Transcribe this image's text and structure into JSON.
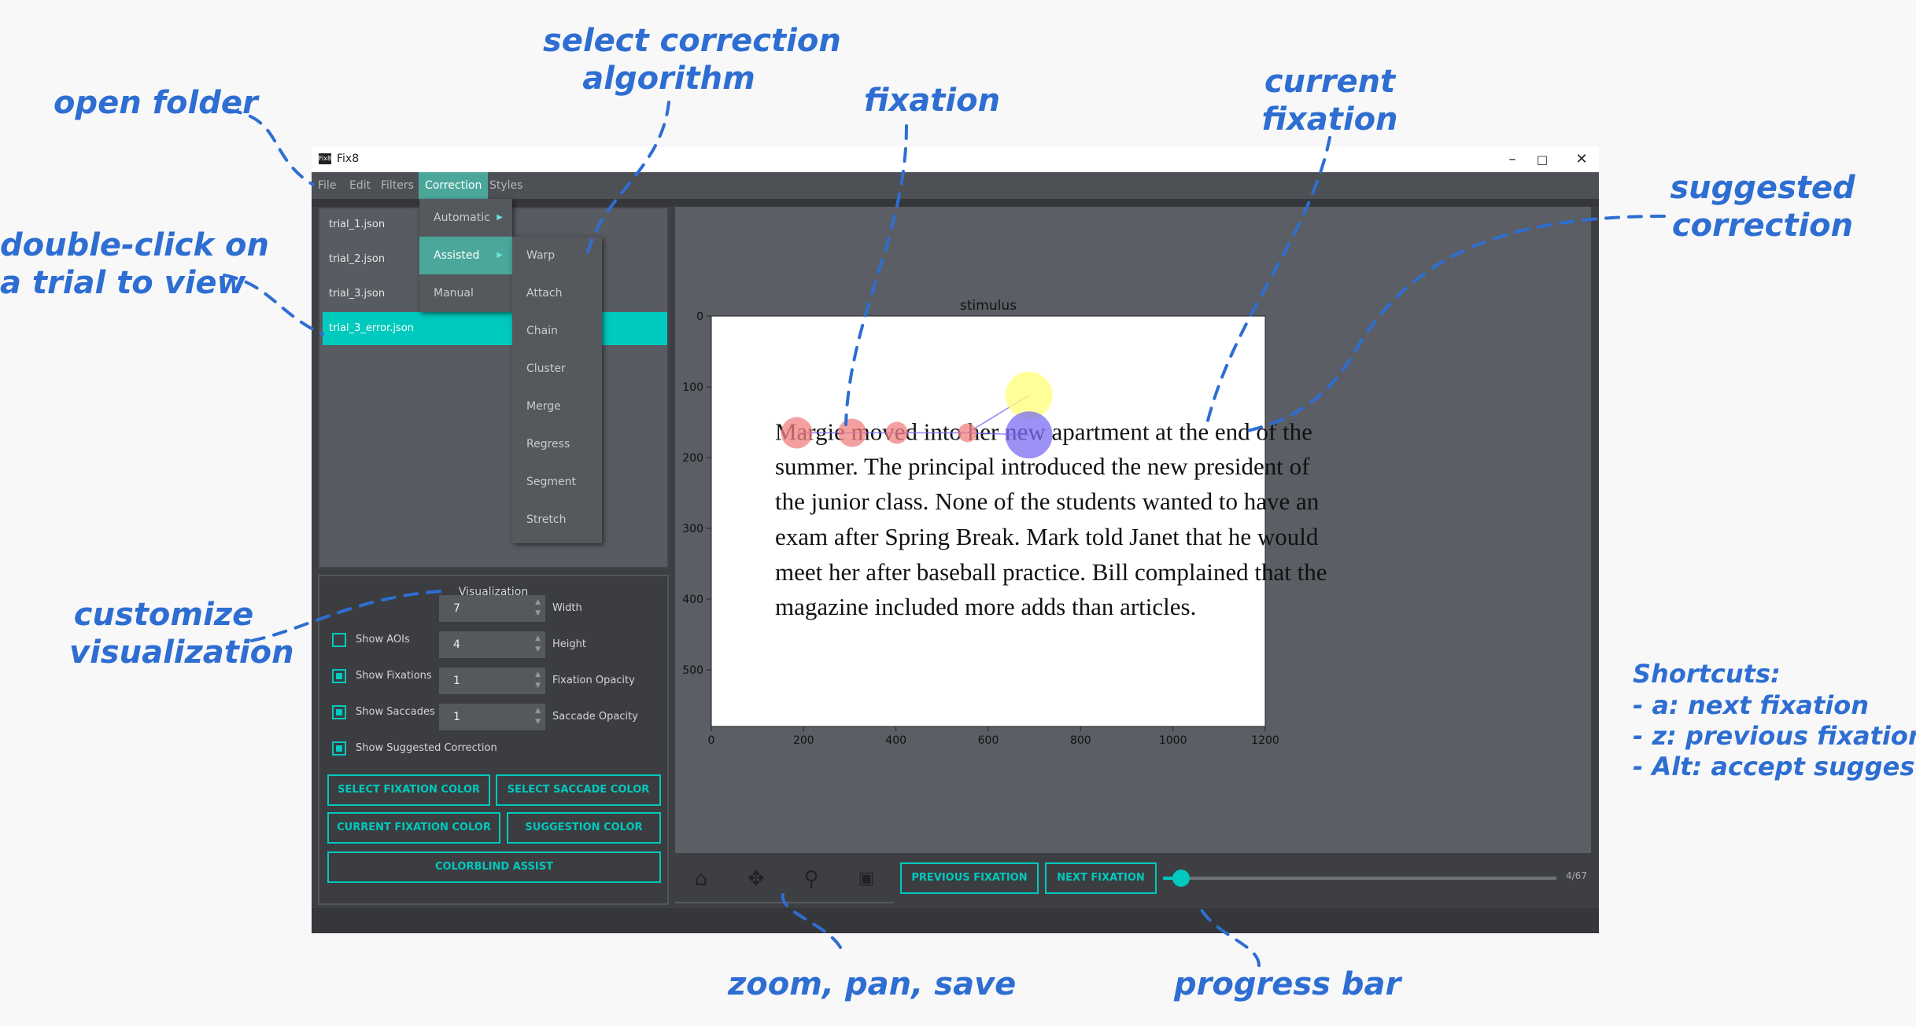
{
  "annotations": {
    "open_folder": "open folder",
    "select_algorithm": "select correction\nalgorithm",
    "fixation": "fixation",
    "current_fixation": "current\nfixation",
    "suggested_correction": "suggested\ncorrection",
    "double_click": "double-click on\na trial to view",
    "customize": "customize\nvisualization",
    "zoom_pan_save": "zoom, pan, save",
    "progress_bar": "progress bar",
    "shortcuts": {
      "title": "Shortcuts:",
      "items": [
        "- a: next fixation",
        "- z: previous fixation",
        "- Alt: accept suggestion"
      ]
    }
  },
  "window": {
    "title": "Fix8",
    "icon_text": "Fix8",
    "controls": [
      "minimize-icon",
      "maximize-icon",
      "close-icon"
    ]
  },
  "menubar": {
    "items": [
      "File",
      "Edit",
      "Filters",
      "Correction",
      "Styles"
    ],
    "active": "Correction"
  },
  "correction_menu": {
    "items": [
      "Automatic",
      "Assisted",
      "Manual"
    ],
    "highlighted": "Assisted"
  },
  "assisted_submenu": {
    "items": [
      "Warp",
      "Attach",
      "Chain",
      "Cluster",
      "Merge",
      "Regress",
      "Segment",
      "Stretch"
    ]
  },
  "trials": {
    "items": [
      "trial_1.json",
      "trial_2.json",
      "trial_3.json",
      "trial_3_error.json"
    ],
    "selected": "trial_3_error.json"
  },
  "visualization": {
    "title": "Visualization",
    "spinboxes": [
      {
        "value": "7",
        "label": "Width"
      },
      {
        "value": "4",
        "label": "Height"
      },
      {
        "value": "1",
        "label": "Fixation Opacity"
      },
      {
        "value": "1",
        "label": "Saccade Opacity"
      }
    ],
    "checkboxes": [
      {
        "label": "Show AOIs",
        "checked": false
      },
      {
        "label": "Show Fixations",
        "checked": true
      },
      {
        "label": "Show Saccades",
        "checked": true
      },
      {
        "label": "Show Suggested Correction",
        "checked": true
      }
    ],
    "buttons": {
      "select_fixation_color": "SELECT FIXATION COLOR",
      "select_saccade_color": "SELECT SACCADE COLOR",
      "current_fixation_color": "CURRENT FIXATION COLOR",
      "suggestion_color": "SUGGESTION COLOR",
      "colorblind_assist": "COLORBLIND ASSIST"
    }
  },
  "toolbar": {
    "tools": [
      "home-icon",
      "pan-icon",
      "zoom-icon",
      "save-icon"
    ],
    "previous_fixation": "PREVIOUS FIXATION",
    "next_fixation": "NEXT FIXATION",
    "progress": {
      "current": 4,
      "total": 67,
      "label": "4/67"
    }
  },
  "colors": {
    "accent": "#00c9bd",
    "menu_active": "#4aa79a",
    "annotation": "#2e6ed2",
    "fixation": "#f08080",
    "current_fixation": "#7b6cf0",
    "suggestion": "#ffff80"
  },
  "chart_data": {
    "type": "scatter",
    "title": "stimulus",
    "xlim": [
      0,
      1200
    ],
    "ylim": [
      580,
      0
    ],
    "xticks": [
      0,
      200,
      400,
      600,
      800,
      1000,
      1200
    ],
    "yticks": [
      0,
      100,
      200,
      300,
      400,
      500
    ],
    "stimulus_text": [
      "Margie moved into her new apartment at the end of the",
      "summer. The principal introduced the new president of",
      "the junior class. None of the students wanted to have an",
      "exam after Spring Break. Mark told Janet that he would",
      "meet her after baseball practice. Bill complained that the",
      "magazine included more adds than articles."
    ],
    "stimulus_text_x": 138,
    "stimulus_line_y": [
      164,
      213,
      262,
      312,
      362,
      411
    ],
    "fixations": [
      {
        "x": 185,
        "y": 165,
        "r": 10
      },
      {
        "x": 305,
        "y": 165,
        "r": 9
      },
      {
        "x": 402,
        "y": 165,
        "r": 7
      },
      {
        "x": 555,
        "y": 165,
        "r": 6
      }
    ],
    "current_fixation": {
      "x": 688,
      "y": 168,
      "r": 15
    },
    "suggested_correction": {
      "x": 688,
      "y": 112,
      "r": 15
    }
  }
}
